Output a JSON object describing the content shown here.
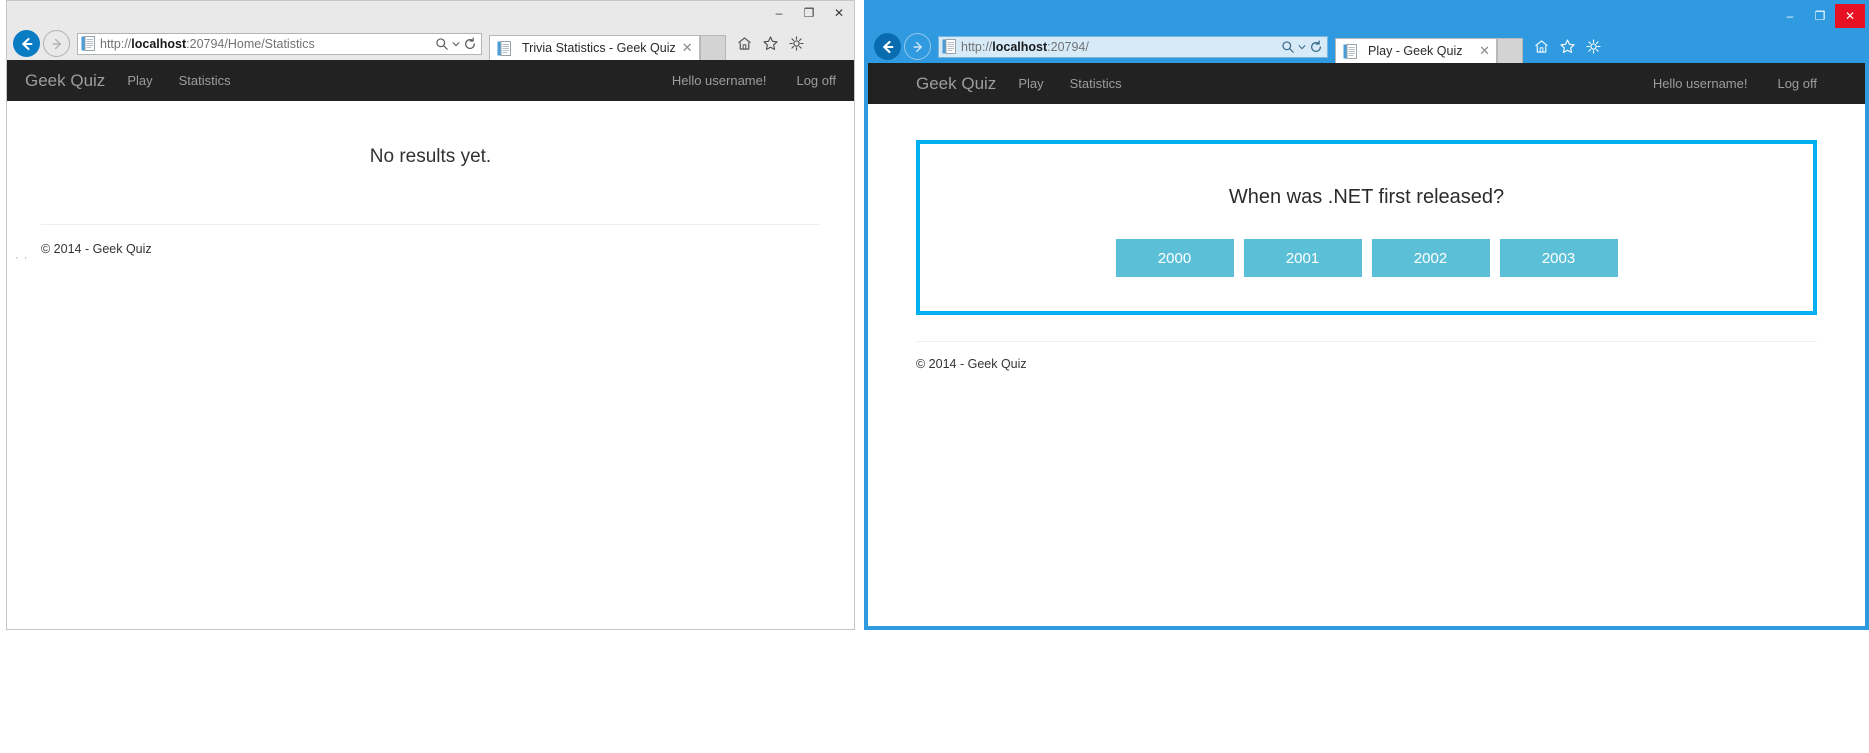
{
  "windows": {
    "left": {
      "state_label": "inactive",
      "caption": {
        "minimize": "–",
        "maximize": "❐",
        "close": "✕"
      },
      "address": {
        "protocol": "http://",
        "host": "localhost",
        "rest": ":20794/Home/Statistics",
        "full": "http://localhost:20794/Home/Statistics"
      },
      "tab": {
        "title": "Trivia Statistics - Geek Quiz",
        "close_label": "✕"
      },
      "page": {
        "navbar": {
          "brand": "Geek Quiz",
          "links": [
            "Play",
            "Statistics"
          ],
          "right_links": [
            "Hello username!",
            "Log off"
          ]
        },
        "message": "No results yet.",
        "copyright": "© 2014 - Geek Quiz",
        "loading_indicator": "· ·"
      }
    },
    "right": {
      "state_label": "active",
      "caption": {
        "minimize": "–",
        "maximize": "❐",
        "close": "✕"
      },
      "address": {
        "protocol": "http://",
        "host": "localhost",
        "rest": ":20794/",
        "full": "http://localhost:20794/"
      },
      "tab": {
        "title": "Play - Geek Quiz",
        "close_label": "✕"
      },
      "page": {
        "navbar": {
          "brand": "Geek Quiz",
          "links": [
            "Play",
            "Statistics"
          ],
          "right_links": [
            "Hello username!",
            "Log off"
          ]
        },
        "quiz": {
          "question": "When was .NET first released?",
          "options": [
            "2000",
            "2001",
            "2002",
            "2003"
          ]
        },
        "copyright": "© 2014 - Geek Quiz"
      }
    }
  },
  "icons": {
    "back": "back-arrow-icon",
    "forward": "forward-arrow-icon",
    "page": "page-icon",
    "search": "search-icon",
    "dropdown": "chevron-down-icon",
    "refresh": "refresh-icon",
    "home": "home-icon",
    "favorites": "star-icon",
    "tools": "gear-icon"
  },
  "colors": {
    "active_window_border": "#2f9ae0",
    "navbar_bg": "#222222",
    "navbar_text": "#9d9d9d",
    "quiz_panel_border": "#00b0f0",
    "quiz_option_bg": "#5bc0d7",
    "close_button_bg": "#e81123"
  }
}
